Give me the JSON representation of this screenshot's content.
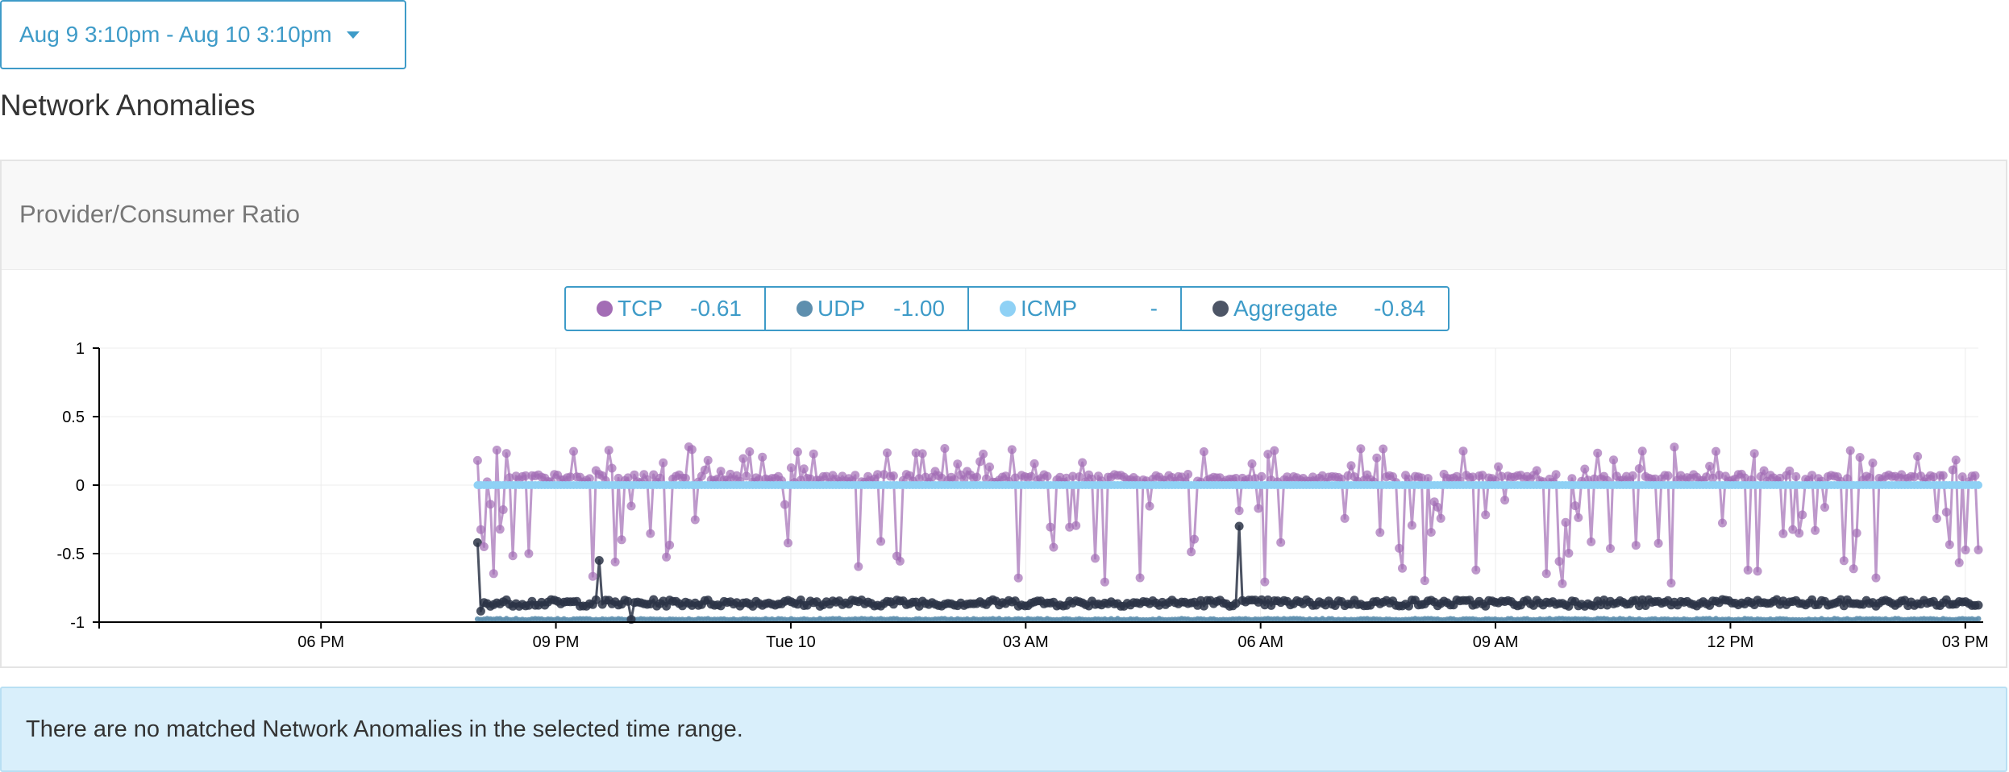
{
  "time_range": {
    "label": "Aug 9 3:10pm - Aug 10 3:10pm"
  },
  "page_title": "Network Anomalies",
  "panel": {
    "title": "Provider/Consumer Ratio"
  },
  "legend": [
    {
      "name": "TCP",
      "value": "-0.61",
      "color": "#a36db5"
    },
    {
      "name": "UDP",
      "value": "-1.00",
      "color": "#5e8fae"
    },
    {
      "name": "ICMP",
      "value": "-",
      "color": "#8fd1f5"
    },
    {
      "name": "Aggregate",
      "value": "-0.84",
      "color": "#4d5566"
    }
  ],
  "alert": {
    "message": "There are no matched Network Anomalies in the selected time range."
  },
  "chart_data": {
    "type": "line",
    "title": "",
    "xlabel": "",
    "ylabel": "",
    "ylim": [
      -1,
      1
    ],
    "y_ticks": [
      "1",
      "0.5",
      "0",
      "-0.5",
      "-1"
    ],
    "y_tick_values": [
      1,
      0.5,
      0,
      -0.5,
      -1
    ],
    "x_range": [
      "Aug 9 3:10pm",
      "Aug 10 3:10pm"
    ],
    "x_ticks": [
      {
        "label": "06 PM",
        "time": "Aug 9 6:00pm"
      },
      {
        "label": "09 PM",
        "time": "Aug 9 9:00pm"
      },
      {
        "label": "Tue 10",
        "time": "Aug 10 12:00am"
      },
      {
        "label": "03 AM",
        "time": "Aug 10 3:00am"
      },
      {
        "label": "06 AM",
        "time": "Aug 10 6:00am"
      },
      {
        "label": "09 AM",
        "time": "Aug 10 9:00am"
      },
      {
        "label": "12 PM",
        "time": "Aug 10 12:00pm"
      },
      {
        "label": "03 PM",
        "time": "Aug 10 3:00pm"
      }
    ],
    "grid": true,
    "data_start": "Aug 9 8:00pm",
    "data_end": "Aug 10 3:10pm",
    "series": [
      {
        "name": "TCP",
        "color": "#a36db5",
        "typical_value": 0.05,
        "min_value": -0.8,
        "max_value": 0.28
      },
      {
        "name": "UDP",
        "color": "#5e8fae",
        "typical_value": -0.98
      },
      {
        "name": "ICMP",
        "color": "#8fd1f5",
        "typical_value": 0
      },
      {
        "name": "Aggregate",
        "color": "#2c3446",
        "typical_value": -0.86,
        "min_value": -1,
        "max_value": -0.3
      }
    ]
  }
}
